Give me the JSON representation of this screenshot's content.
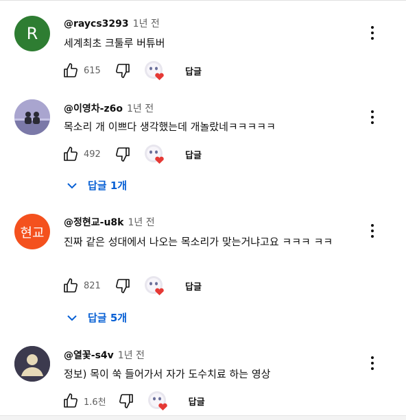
{
  "comments": [
    {
      "author": "@raycs3293",
      "time": "1년 전",
      "text": "세계최초 크툴루 버튜버",
      "likes": "615",
      "reply_label": "답글",
      "avatar": {
        "type": "letter",
        "label": "R",
        "color": "#2e7d32"
      }
    },
    {
      "author": "@이영차-z6o",
      "time": "1년 전",
      "text": "목소리 개 이쁘다 생각했는데 개놀랐네ㅋㅋㅋㅋㅋ",
      "likes": "492",
      "reply_label": "답글",
      "avatar": {
        "type": "photo"
      },
      "replies_toggle": "답글 1개"
    },
    {
      "author": "@정현교-u8k",
      "time": "1년 전",
      "text": "진짜 같은 성대에서 나오는 목소리가 맞는거냐고요 ㅋㅋㅋ ㅋㅋ",
      "likes": "821",
      "reply_label": "답글",
      "avatar": {
        "type": "text",
        "label": "현교",
        "color": "#f4511e"
      },
      "replies_toggle": "답글 5개"
    },
    {
      "author": "@열꽃-s4v",
      "time": "1년 전",
      "text": "정보) 목이 쑥 들어가서 자가 도수치료 하는 영상",
      "likes": "1.6천",
      "reply_label": "답글",
      "avatar": {
        "type": "silhouette"
      }
    }
  ],
  "colors": {
    "link": "#065fd4",
    "muted": "#606060",
    "heart": "#e53935"
  },
  "icons": [
    "thumbs-up-icon",
    "thumbs-down-icon",
    "creator-heart-icon",
    "more-vert-icon",
    "chevron-down-icon"
  ]
}
